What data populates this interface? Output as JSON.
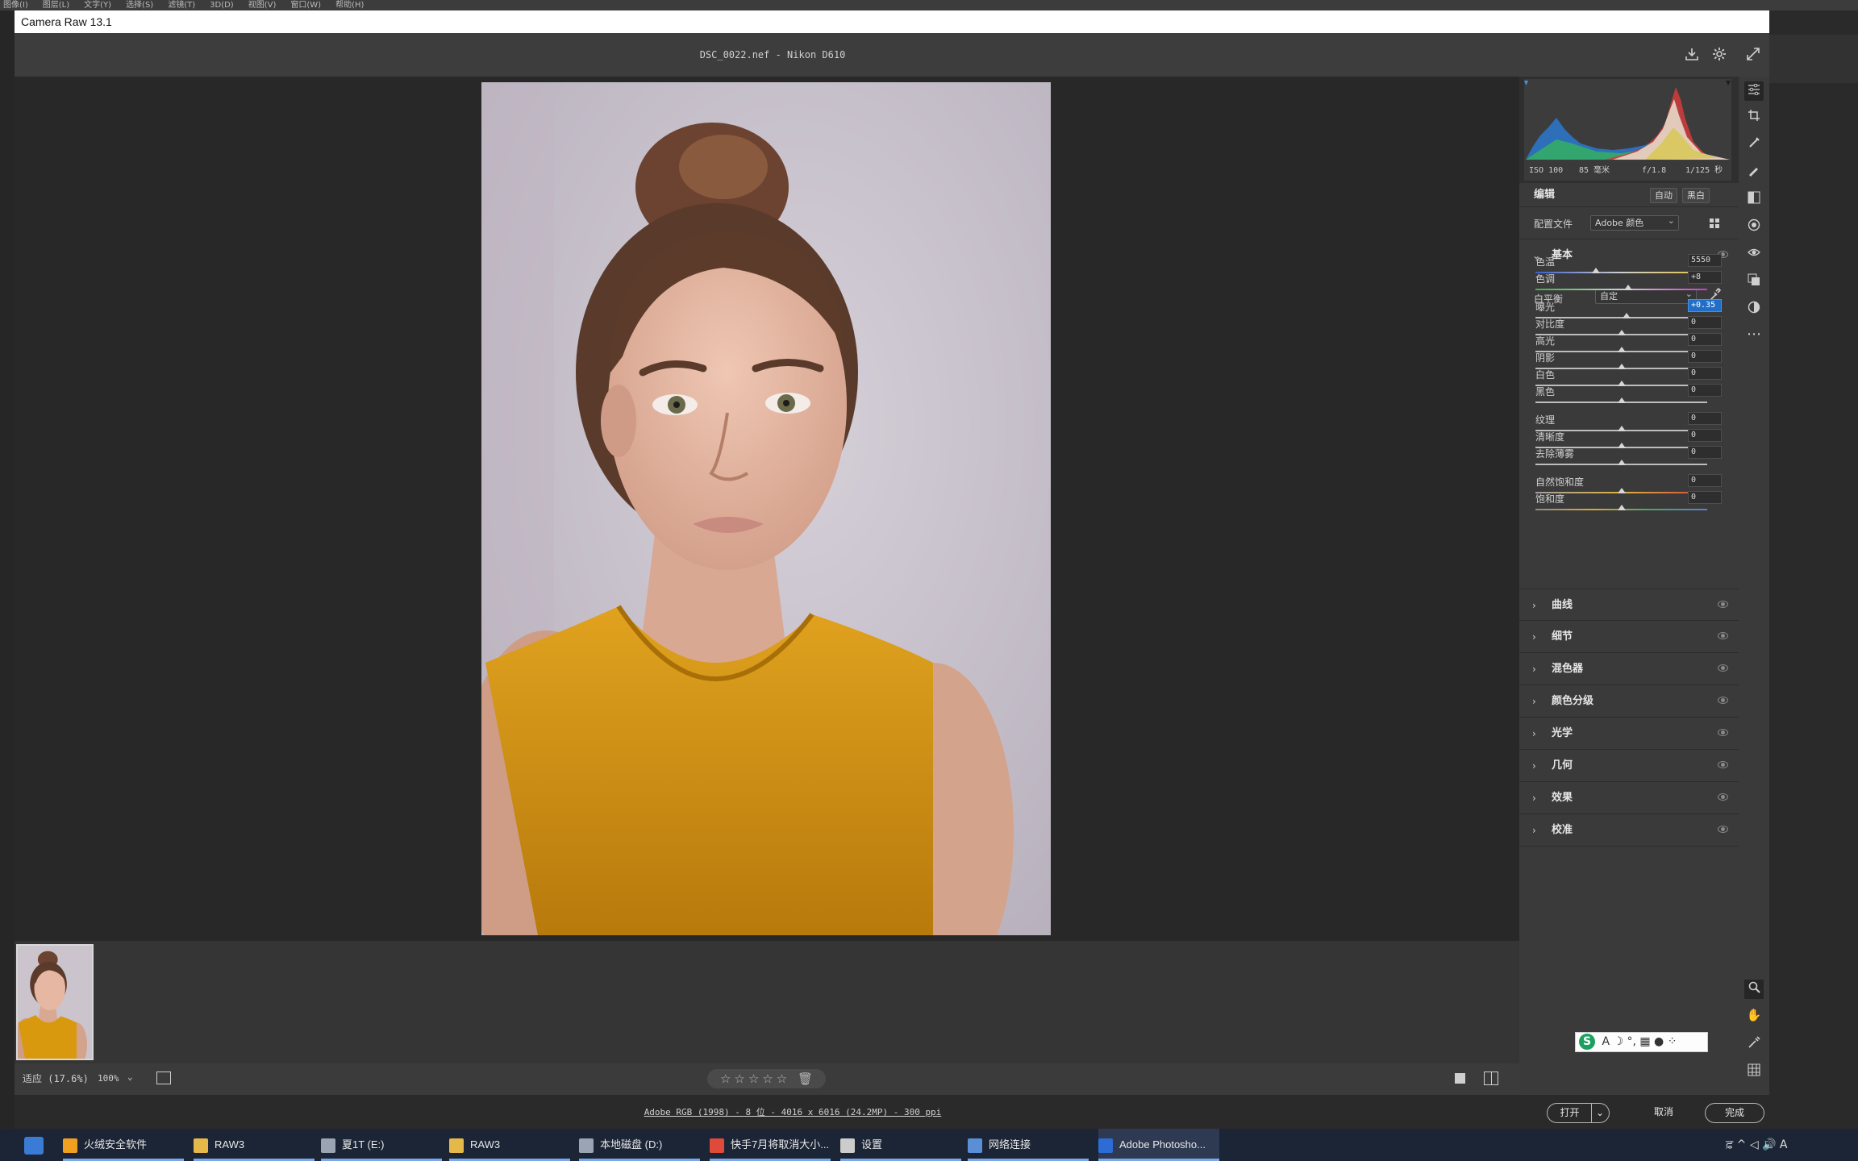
{
  "ps_menu": [
    "图像(I)",
    "图层(L)",
    "文字(Y)",
    "选择(S)",
    "滤镜(T)",
    "3D(D)",
    "视图(V)",
    "窗口(W)",
    "帮助(H)"
  ],
  "window": {
    "title": "Camera Raw 13.1",
    "filename": "DSC_0022.nef -  Nikon D610"
  },
  "camera_info": {
    "iso": "ISO 100",
    "focal": "85 毫米",
    "aperture": "f/1.8",
    "shutter": "1/125 秒"
  },
  "edit": {
    "title": "编辑",
    "auto_btn": "自动",
    "bw_btn": "黑白",
    "profile_label": "配置文件",
    "profile_value": "Adobe 颜色"
  },
  "basic": {
    "title": "基本",
    "wb_label": "白平衡",
    "wb_value": "自定",
    "sliders": [
      {
        "label": "色温",
        "value": "5550",
        "pos": 0.35
      },
      {
        "label": "色调",
        "value": "+8",
        "pos": 0.54
      },
      {
        "label": "曝光",
        "value": "+0.35",
        "pos": 0.53
      },
      {
        "label": "对比度",
        "value": "0",
        "pos": 0.5
      },
      {
        "label": "高光",
        "value": "0",
        "pos": 0.5
      },
      {
        "label": "阴影",
        "value": "0",
        "pos": 0.5
      },
      {
        "label": "白色",
        "value": "0",
        "pos": 0.5
      },
      {
        "label": "黑色",
        "value": "0",
        "pos": 0.5
      },
      {
        "label": "纹理",
        "value": "0",
        "pos": 0.5
      },
      {
        "label": "清晰度",
        "value": "0",
        "pos": 0.5
      },
      {
        "label": "去除薄雾",
        "value": "0",
        "pos": 0.5
      },
      {
        "label": "自然饱和度",
        "value": "0",
        "pos": 0.5
      },
      {
        "label": "饱和度",
        "value": "0",
        "pos": 0.5
      }
    ]
  },
  "sections": [
    "曲线",
    "细节",
    "混色器",
    "颜色分级",
    "光学",
    "几何",
    "效果",
    "校准"
  ],
  "status": {
    "zoom_label": "适应 (17.6%)",
    "zoom_value": "100%",
    "rating": "☆☆☆☆☆"
  },
  "footer": {
    "workflow": "Adobe RGB (1998) - 8 位 - 4016 x 6016 (24.2MP) - 300 ppi",
    "open_btn": "打开",
    "cancel_btn": "取消",
    "done_btn": "完成"
  },
  "ime": {
    "logo": "S",
    "keys": "A ☽ °, ▦ ● ⁘"
  },
  "taskbar": [
    {
      "label": "火绒安全软件",
      "icon_color": "#f0a020"
    },
    {
      "label": "RAW3",
      "icon_color": "#e6b84a"
    },
    {
      "label": "夏1T (E:)",
      "icon_color": "#9aa4b2"
    },
    {
      "label": "RAW3",
      "icon_color": "#e6b84a"
    },
    {
      "label": "本地磁盘 (D:)",
      "icon_color": "#9aa4b2"
    },
    {
      "label": "快手7月将取消大小...",
      "icon_color": "#e04a3a"
    },
    {
      "label": "设置",
      "icon_color": "#cccccc"
    },
    {
      "label": "网络连接",
      "icon_color": "#5a8fd8"
    },
    {
      "label": "Adobe Photosho...",
      "icon_color": "#2d6bd6"
    }
  ],
  "tray": "ਫ਼ ^ ◁ 🔊 A"
}
